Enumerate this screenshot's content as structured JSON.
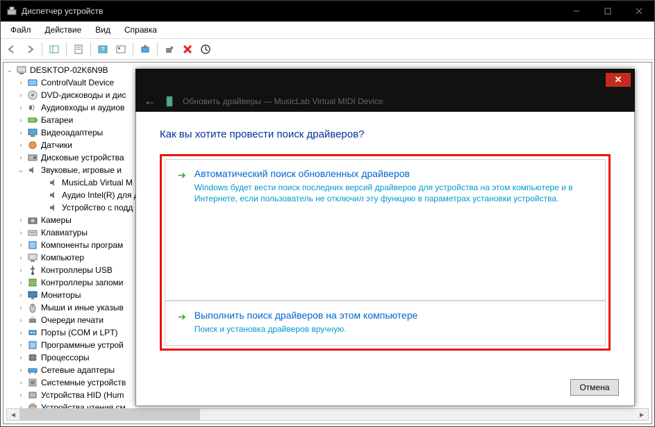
{
  "window": {
    "title": "Диспетчер устройств"
  },
  "menubar": {
    "file": "Файл",
    "action": "Действие",
    "view": "Вид",
    "help": "Справка"
  },
  "tree": {
    "root": "DESKTOP-02K6N9B",
    "items": [
      "ControlVault Device",
      "DVD-дисководы и дис",
      "Аудиовходы и аудиов",
      "Батареи",
      "Видеоадаптеры",
      "Датчики",
      "Дисковые устройства",
      "Звуковые, игровые и"
    ],
    "sound_children": [
      "MusicLab Virtual M",
      "Аудио Intel(R) для д",
      "Устройство с подд"
    ],
    "items2": [
      "Камеры",
      "Клавиатуры",
      "Компоненты програм",
      "Компьютер",
      "Контроллеры USB",
      "Контроллеры запоми",
      "Мониторы",
      "Мыши и иные указыв",
      "Очереди печати",
      "Порты (COM и LPT)",
      "Программные устрой",
      "Процессоры",
      "Сетевые адаптеры",
      "Системные устройств",
      "Устройства HID (Hum",
      "Устройства чтения см"
    ]
  },
  "dialog": {
    "header_title": "Обновить драйверы — MusicLab Virtual MIDI Device",
    "question": "Как вы хотите провести поиск драйверов?",
    "opt1_title": "Автоматический поиск обновленных драйверов",
    "opt1_desc": "Windows будет вести поиск последних версий драйверов для устройства на этом компьютере и в Интернете, если пользователь не отключил эту функцию в параметрах установки устройства.",
    "opt2_title": "Выполнить поиск драйверов на этом компьютере",
    "opt2_desc": "Поиск и установка драйверов вручную.",
    "cancel": "Отмена"
  }
}
